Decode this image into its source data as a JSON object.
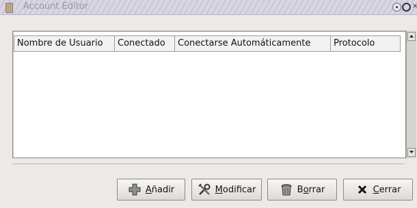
{
  "window": {
    "title": "Account Editor"
  },
  "table": {
    "columns": [
      "Nombre de Usuario",
      "Conectado",
      "Conectarse Automáticamente",
      "Protocolo"
    ],
    "rows": []
  },
  "buttons": {
    "add": {
      "label_mnemonic": "A",
      "label_rest": "ñadir",
      "icon": "plus-icon"
    },
    "modify": {
      "label_mnemonic": "M",
      "label_rest": "odificar",
      "icon": "tools-icon"
    },
    "delete": {
      "label_pre": "B",
      "label_mnemonic": "o",
      "label_rest": "rrar",
      "icon": "trash-icon"
    },
    "close": {
      "label_mnemonic": "C",
      "label_rest": "errar",
      "icon": "close-x-icon"
    }
  }
}
